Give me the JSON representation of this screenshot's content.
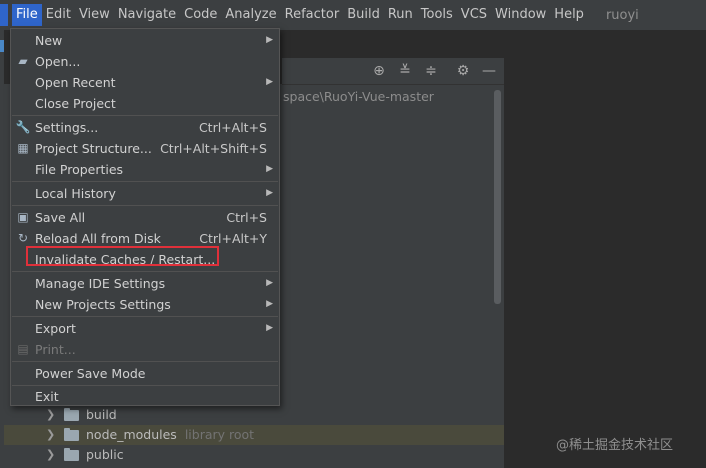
{
  "menubar": {
    "items": [
      "File",
      "Edit",
      "View",
      "Navigate",
      "Code",
      "Analyze",
      "Refactor",
      "Build",
      "Run",
      "Tools",
      "VCS",
      "Window",
      "Help"
    ],
    "project_name": "ruoyi"
  },
  "project_panel": {
    "path_text": "space\\RuoYi-Vue-master",
    "tree": [
      {
        "name": "build",
        "extra": ""
      },
      {
        "name": "node_modules",
        "extra": "library root"
      },
      {
        "name": "public",
        "extra": ""
      }
    ]
  },
  "file_menu": {
    "new": "New",
    "open": "Open...",
    "open_recent": "Open Recent",
    "close_project": "Close Project",
    "settings": "Settings...",
    "settings_sc": "Ctrl+Alt+S",
    "project_structure": "Project Structure...",
    "project_structure_sc": "Ctrl+Alt+Shift+S",
    "file_properties": "File Properties",
    "local_history": "Local History",
    "save_all": "Save All",
    "save_all_sc": "Ctrl+S",
    "reload": "Reload All from Disk",
    "reload_sc": "Ctrl+Alt+Y",
    "invalidate": "Invalidate Caches / Restart...",
    "manage_ide": "Manage IDE Settings",
    "new_projects_settings": "New Projects Settings",
    "export": "Export",
    "print": "Print...",
    "power_save": "Power Save Mode",
    "exit": "Exit"
  },
  "watermark": "@稀土掘金技术社区"
}
